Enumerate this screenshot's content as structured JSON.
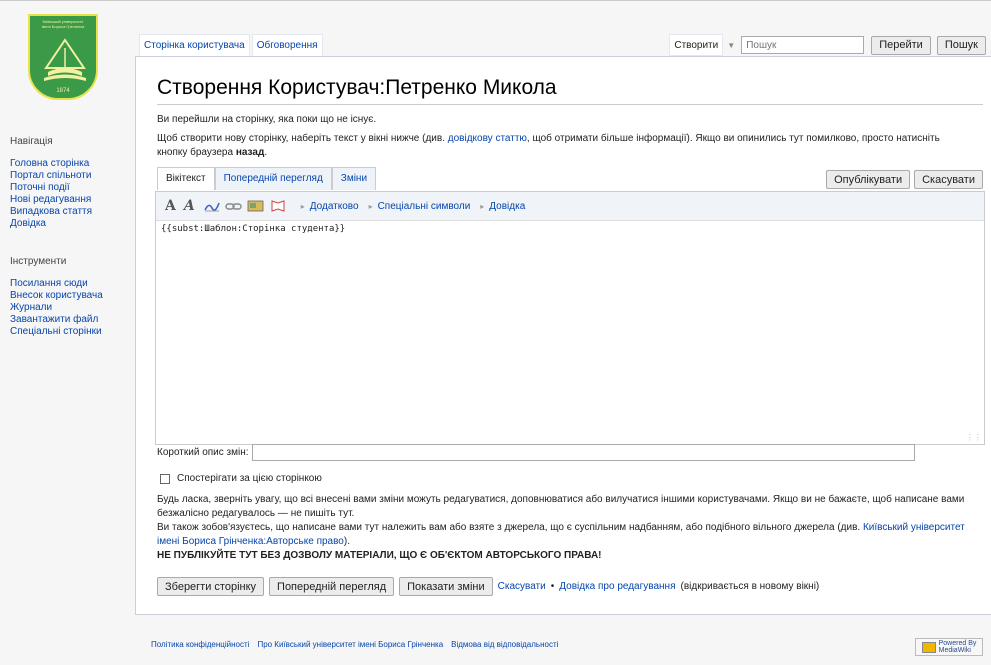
{
  "logo": {
    "line1": "Київський університет",
    "line2": "імені Бориса Грінченка",
    "year": "1874"
  },
  "sidebar": {
    "nav_heading": "Навігація",
    "nav_items": [
      {
        "label": "Головна сторінка"
      },
      {
        "label": "Портал спільноти"
      },
      {
        "label": "Поточні події"
      },
      {
        "label": "Нові редагування"
      },
      {
        "label": "Випадкова стаття"
      },
      {
        "label": "Довідка"
      }
    ],
    "tools_heading": "Інструменти",
    "tools_items": [
      {
        "label": "Посилання сюди"
      },
      {
        "label": "Внесок користувача"
      },
      {
        "label": "Журнали"
      },
      {
        "label": "Завантажити файл"
      },
      {
        "label": "Спеціальні сторінки"
      }
    ]
  },
  "tabs": {
    "user_page": "Сторінка користувача",
    "discussion": "Обговорення",
    "create": "Створити"
  },
  "search": {
    "placeholder": "Пошук",
    "go_label": "Перейти",
    "search_label": "Пошук"
  },
  "page": {
    "title": "Створення Користувач:Петренко Микола",
    "intro": "Ви перейшли на сторінку, яка поки що не існує.",
    "help_pre": "Щоб створити нову сторінку, наберіть текст у вікні нижче (див. ",
    "help_link": "довідкову статтю",
    "help_mid": ", щоб отримати більше інформації). Якщо ви опинились тут помилково, просто натисніть кнопку браузера ",
    "help_bold": "назад",
    "help_end": "."
  },
  "editor": {
    "tab_wikitext": "Вікітекст",
    "tab_preview": "Попередній перегляд",
    "tab_changes": "Зміни",
    "publish_label": "Опублікувати",
    "cancel_label": "Скасувати",
    "toolbar": {
      "bold": "A",
      "italic": "A",
      "advanced": "Додатково",
      "special_chars": "Спеціальні символи",
      "help": "Довідка"
    },
    "content": "{{subst:Шаблон:Сторінка студента}}"
  },
  "summary": {
    "label": "Короткий опис змін:",
    "value": ""
  },
  "watch": {
    "label": "Спостерігати за цією сторінкою",
    "checked": false
  },
  "warning": {
    "line1": "Будь ласка, зверніть увагу, що всі внесені вами зміни можуть редагуватися, доповнюватися або вилучатися іншими користувачами. Якщо ви не бажаєте, щоб написане вами безжалісно редагувалось — не пишіть тут.",
    "line2_pre": "Ви також зобов'язуєтесь, що написане вами тут належить вам або взяте з джерела, що є суспільним надбанням, або подібного вільного джерела (див. ",
    "line2_link": "Київський університет імені Бориса Грінченка:Авторське право",
    "line2_end": ").",
    "bold": "НЕ ПУБЛІКУЙТЕ ТУТ БЕЗ ДОЗВОЛУ МАТЕРІАЛИ, ЩО Є ОБ'ЄКТОМ АВТОРСЬКОГО ПРАВА!"
  },
  "save_bar": {
    "save": "Зберегти сторінку",
    "preview": "Попередній перегляд",
    "show_changes": "Показати зміни",
    "cancel": "Скасувати",
    "sep": "•",
    "help_link": "Довідка про редагування",
    "help_note": "(відкривається в новому вікні)"
  },
  "footer": {
    "privacy": "Політика конфіденційності",
    "about": "Про Київський університет імені Бориса Грінченка",
    "disclaimer": "Відмова від відповідальності",
    "badge_line1": "Powered By",
    "badge_line2": "MediaWiki"
  },
  "colors": {
    "link": "#0645ad",
    "logo_green": "#3a9a48",
    "logo_yellow": "#e8e24a"
  }
}
